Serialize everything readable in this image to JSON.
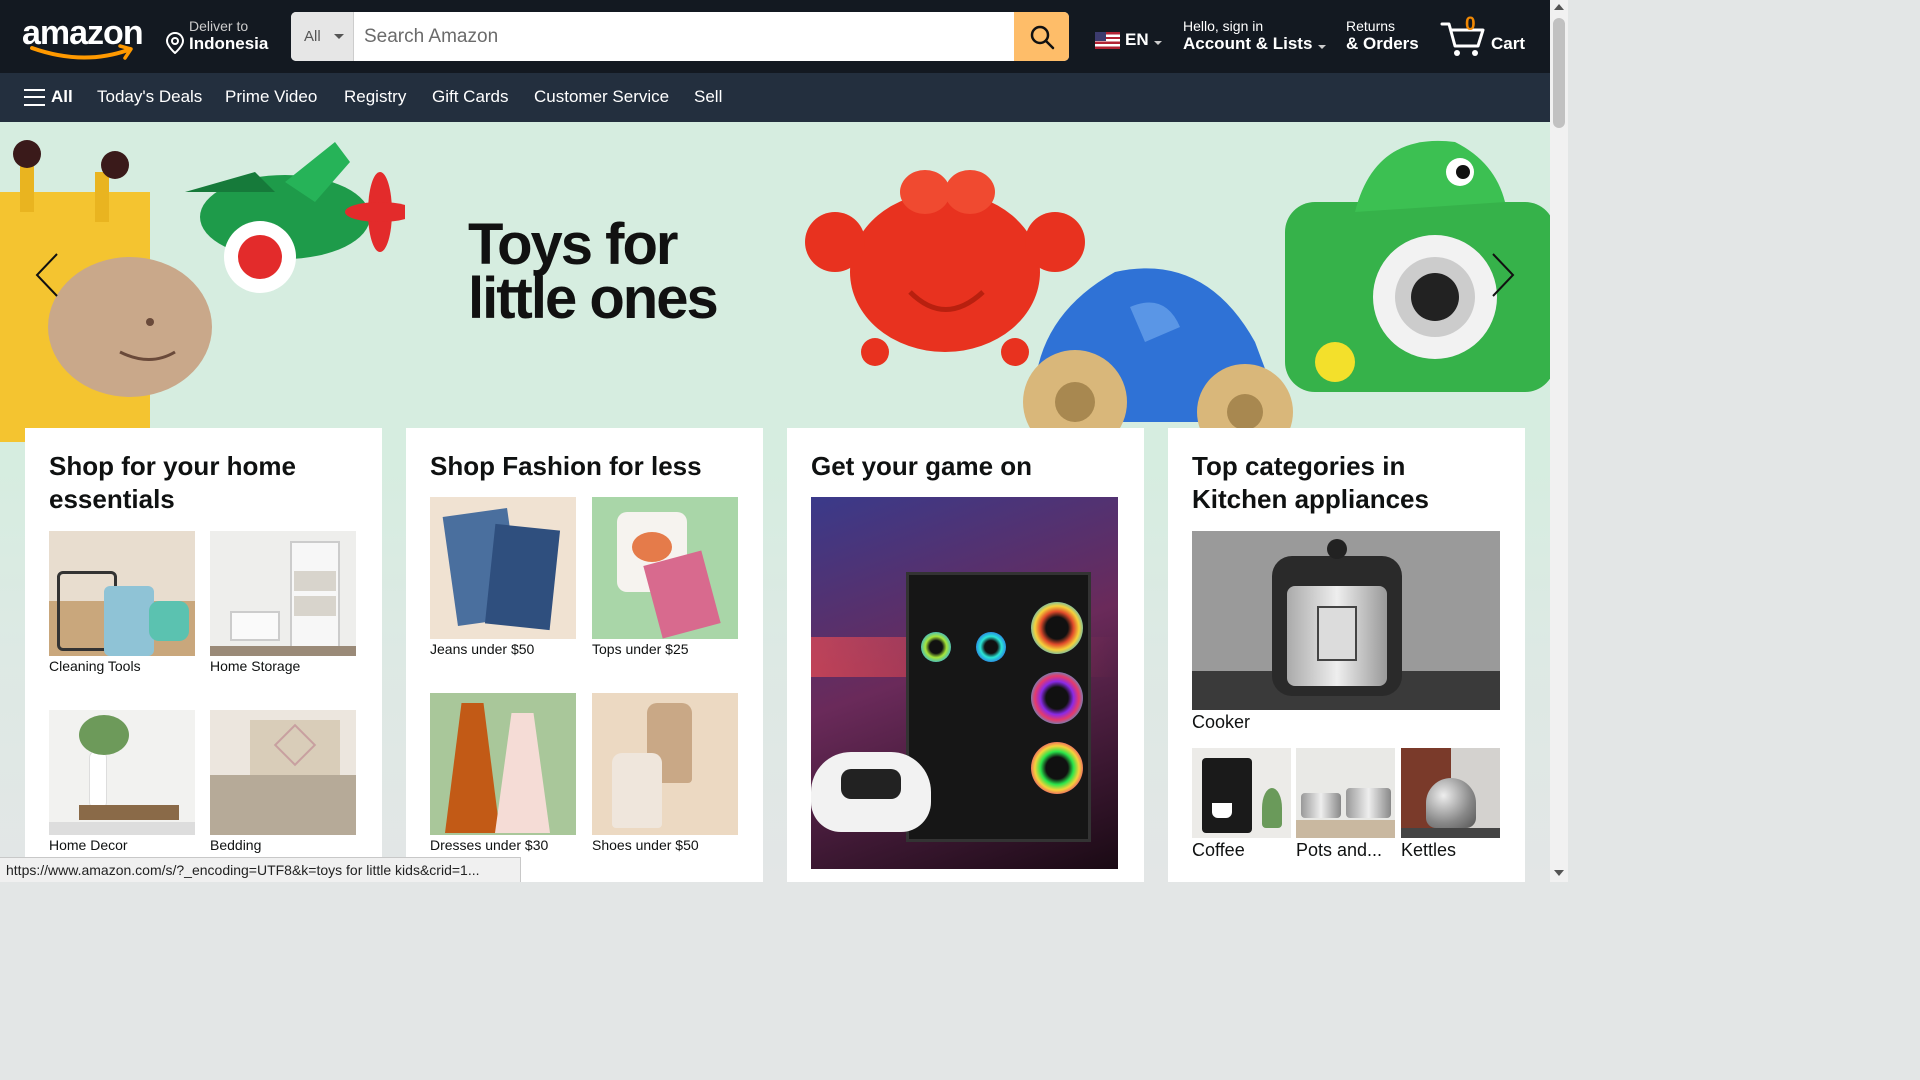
{
  "header": {
    "logo_text": "amazon",
    "deliver_line1": "Deliver to",
    "deliver_line2": "Indonesia",
    "search_category": "All",
    "search_placeholder": "Search Amazon",
    "language": "EN",
    "account_line1": "Hello, sign in",
    "account_line2": "Account & Lists",
    "returns_line1": "Returns",
    "returns_line2": "& Orders",
    "cart_count": "0",
    "cart_label": "Cart"
  },
  "subnav": {
    "all_label": "All",
    "items": [
      "Today's Deals",
      "Prime Video",
      "Registry",
      "Gift Cards",
      "Customer Service",
      "Sell"
    ]
  },
  "hero": {
    "title_line1": "Toys for",
    "title_line2": "little ones"
  },
  "cards": [
    {
      "title": "Shop for your home essentials",
      "tiles": [
        "Cleaning Tools",
        "Home Storage",
        "Home Decor",
        "Bedding"
      ]
    },
    {
      "title": "Shop Fashion for less",
      "tiles": [
        "Jeans under $50",
        "Tops under $25",
        "Dresses under $30",
        "Shoes under $50"
      ]
    },
    {
      "title": "Get your game on"
    },
    {
      "title": "Top categories in Kitchen appliances",
      "main_tile": "Cooker",
      "tiles": [
        "Coffee",
        "Pots and...",
        "Kettles"
      ]
    }
  ],
  "status_url": "https://www.amazon.com/s/?_encoding=UTF8&k=toys for little kids&crid=1...",
  "colors": {
    "nav_bg": "#131921",
    "subnav_bg": "#232f3e",
    "search_button": "#febd69",
    "cart_count": "#f08804",
    "hero_bg": "#d6ede0"
  }
}
